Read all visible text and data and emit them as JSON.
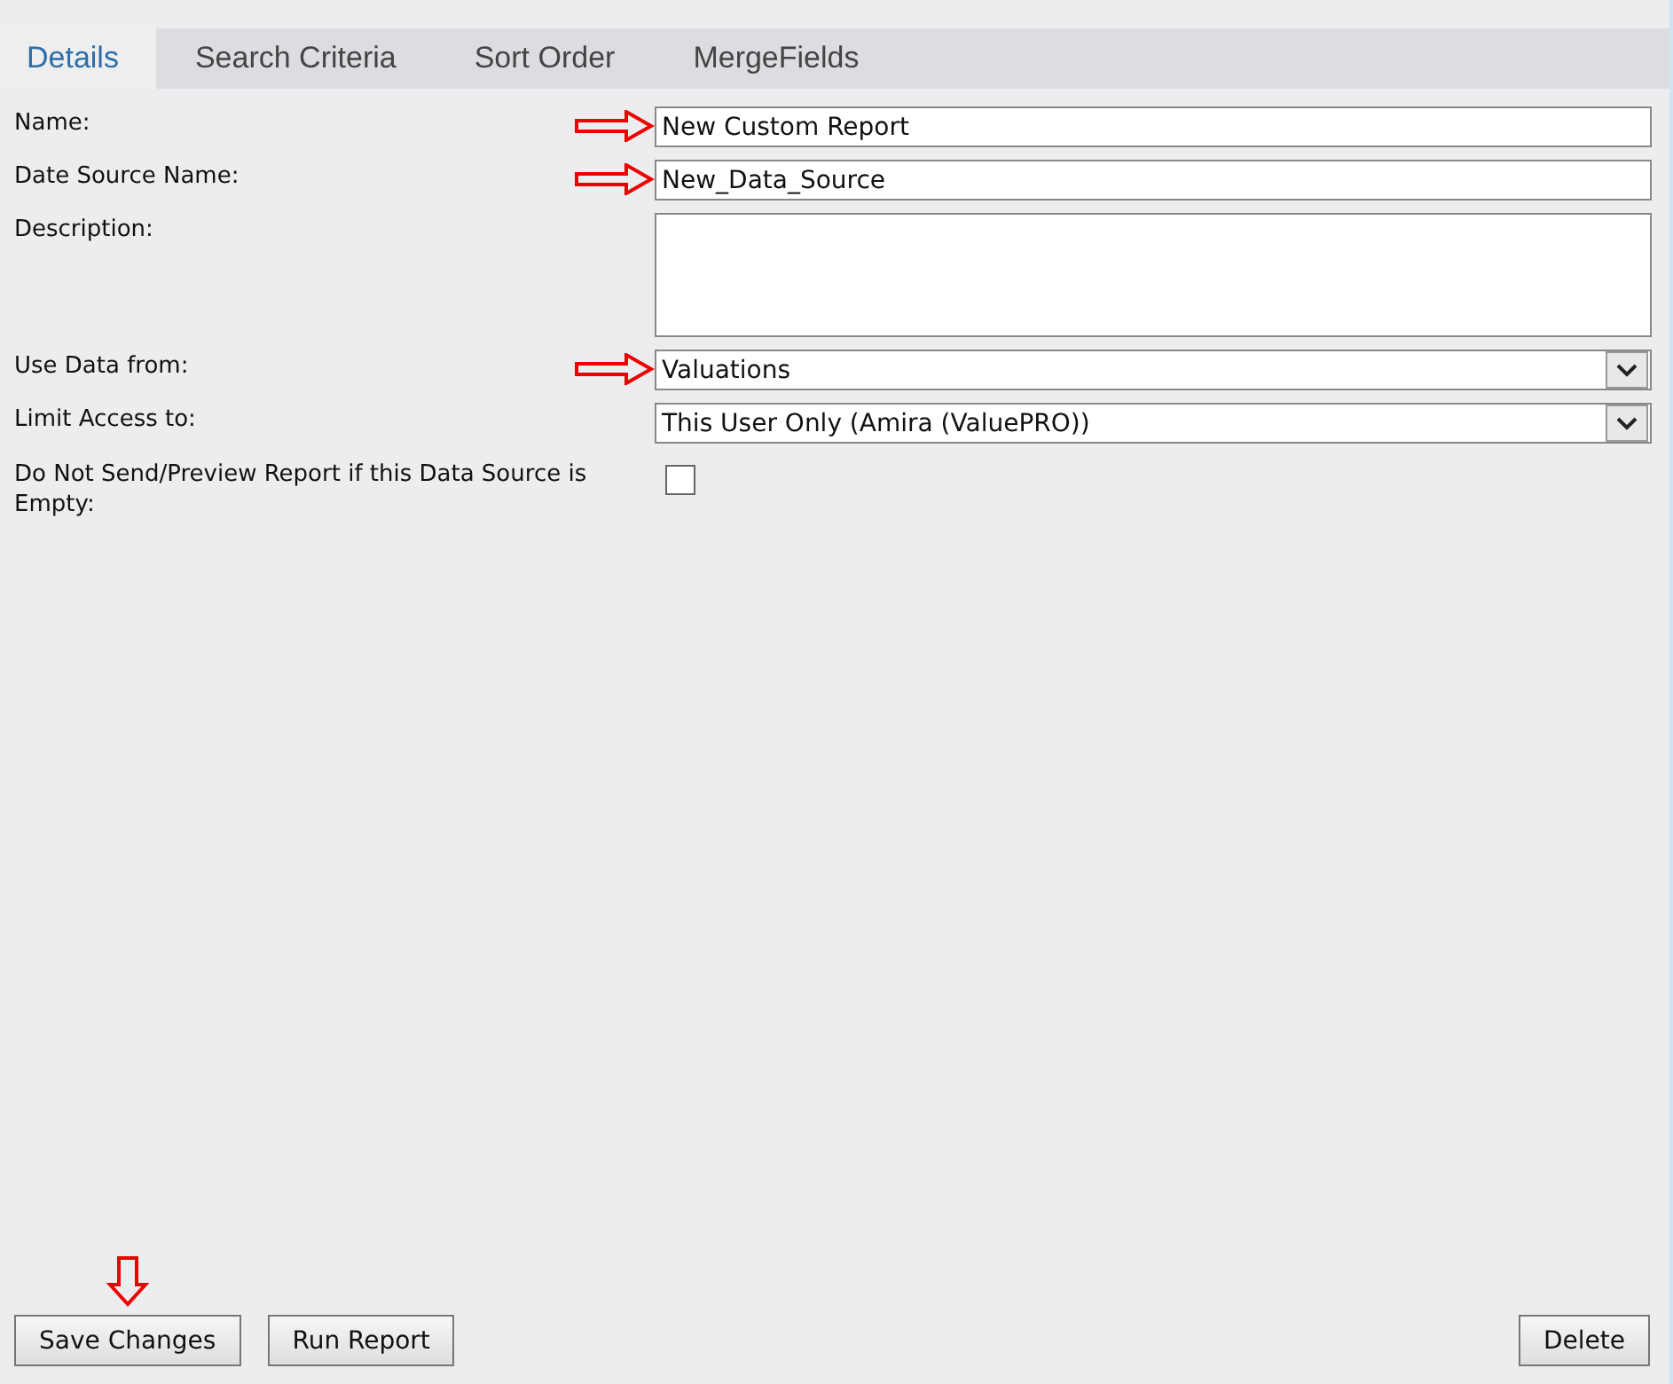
{
  "tabs": [
    {
      "label": "Details",
      "selected": true
    },
    {
      "label": "Search Criteria",
      "selected": false
    },
    {
      "label": "Sort Order",
      "selected": false
    },
    {
      "label": "MergeFields",
      "selected": false
    }
  ],
  "fields": [
    {
      "kind": "text",
      "label": "Name:",
      "value": "New Custom Report",
      "arrow": true
    },
    {
      "kind": "text",
      "label": "Date Source Name:",
      "value": "New_Data_Source",
      "arrow": true
    },
    {
      "kind": "textarea",
      "label": "Description:",
      "arrow": false
    },
    {
      "kind": "select",
      "label": "Use Data from:",
      "value": "Valuations",
      "arrow": true
    },
    {
      "kind": "select",
      "label": "Limit Access to:",
      "value": "This User Only (Amira (ValuePRO))",
      "arrow": false
    },
    {
      "kind": "checkbox",
      "label": "Do Not Send/Preview Report if this Data Source is Empty:",
      "checked": false,
      "arrow": false
    }
  ],
  "buttons": [
    {
      "label": "Save Changes",
      "arrow": true
    },
    {
      "label": "Run Report",
      "arrow": false
    },
    {
      "label": "Delete",
      "arrow": false
    }
  ]
}
